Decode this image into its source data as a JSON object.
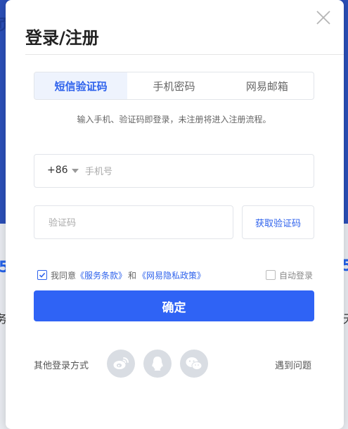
{
  "background": {
    "left_glyph": "页",
    "right_glyph": "5",
    "left_mid_glyph": "务",
    "right_mid_glyph": "无"
  },
  "modal": {
    "title": "登录/注册",
    "close_icon": "close-icon"
  },
  "tabs": [
    {
      "label": "短信验证码",
      "active": true
    },
    {
      "label": "手机密码",
      "active": false
    },
    {
      "label": "网易邮箱",
      "active": false
    }
  ],
  "hint": "输入手机、验证码即登录，未注册将进入注册流程。",
  "phone": {
    "country_code": "+86",
    "placeholder": "手机号"
  },
  "code": {
    "placeholder": "验证码",
    "get_code_label": "获取验证码"
  },
  "agreement": {
    "checked": true,
    "prefix": "我同意",
    "terms_link": "《服务条款》",
    "and": "和",
    "privacy_link": "《网易隐私政策》"
  },
  "auto_login": {
    "label": "自动登录",
    "checked": false
  },
  "submit_label": "确定",
  "other_login": {
    "label": "其他登录方式",
    "icons": [
      "weibo-icon",
      "qq-icon",
      "wechat-icon"
    ]
  },
  "problem_link": "遇到问题",
  "colors": {
    "accent": "#2e62ec",
    "button": "#2f63f5",
    "social_bg": "#d9dde3"
  }
}
